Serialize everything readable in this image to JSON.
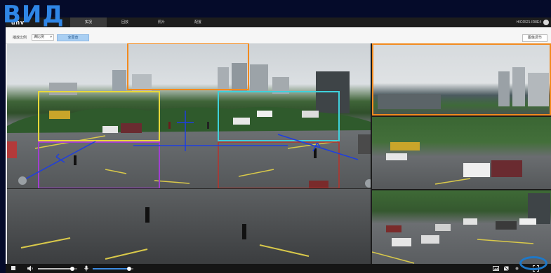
{
  "caption": "ВИД",
  "app": {
    "logo": "unv",
    "device_id": "HIC6521-IR8E4"
  },
  "nav": {
    "tabs": [
      {
        "label": "实况",
        "active": true
      },
      {
        "label": "回放",
        "active": false
      },
      {
        "label": "照片",
        "active": false
      },
      {
        "label": "配置",
        "active": false
      }
    ]
  },
  "toolbar": {
    "ratio_label": "播放比例",
    "ratio_value": "满比例",
    "mode_button": "全局查",
    "adjust_button": "图像调节"
  },
  "controls": {
    "volume_level": 0.88,
    "mic_level": 0.9
  },
  "colors": {
    "accent": "#3d8be0",
    "roi_orange": "#f28a1e",
    "roi_yellow": "#e8d93a",
    "roi_cyan": "#3fd2dc",
    "roi_purple": "#a13fd0",
    "roi_red": "#b8322a",
    "guide_blue": "#1e3ee0",
    "caption": "#2f86e6",
    "highlight": "#1e78c8"
  },
  "icons": [
    "user-icon",
    "stop-icon",
    "speaker-icon",
    "microphone-icon",
    "snapshot-icon",
    "record-icon",
    "settings-dot-icon",
    "fullscreen-icon"
  ]
}
